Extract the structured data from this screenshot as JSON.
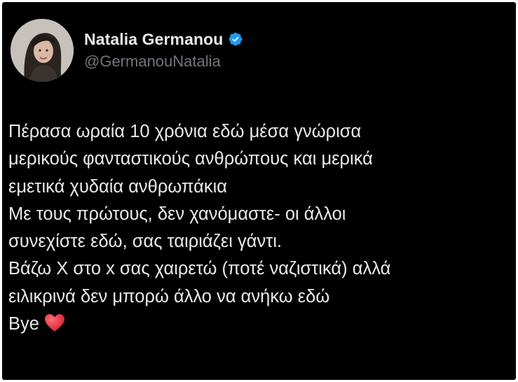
{
  "tweet": {
    "author": {
      "display_name": "Natalia Germanou",
      "handle": "@GermanouNatalia",
      "verified": true,
      "verified_color": "#1d9bf0"
    },
    "lines": [
      "Πέρασα ωραία 10 χρόνια εδώ μέσα γνώρισα",
      "μερικούς φανταστικούς ανθρώπους και μερικά",
      "εμετικά χυδαία ανθρωπάκια",
      "Με τους πρώτους, δεν χανόμαστε- οι άλλοι",
      "συνεχίστε εδώ, σας ταιριάζει γάντι.",
      "Βάζω Χ στο x σας χαιρετώ (ποτέ ναζιστικά) αλλά",
      "ειλικρινά δεν μπορώ άλλο να ανήκω εδώ",
      "Bye"
    ],
    "emoji": "heart-icon",
    "theme": {
      "background": "#000000",
      "text": "#e7e9ea",
      "muted": "#71767b",
      "heart": "#e0323f"
    }
  }
}
